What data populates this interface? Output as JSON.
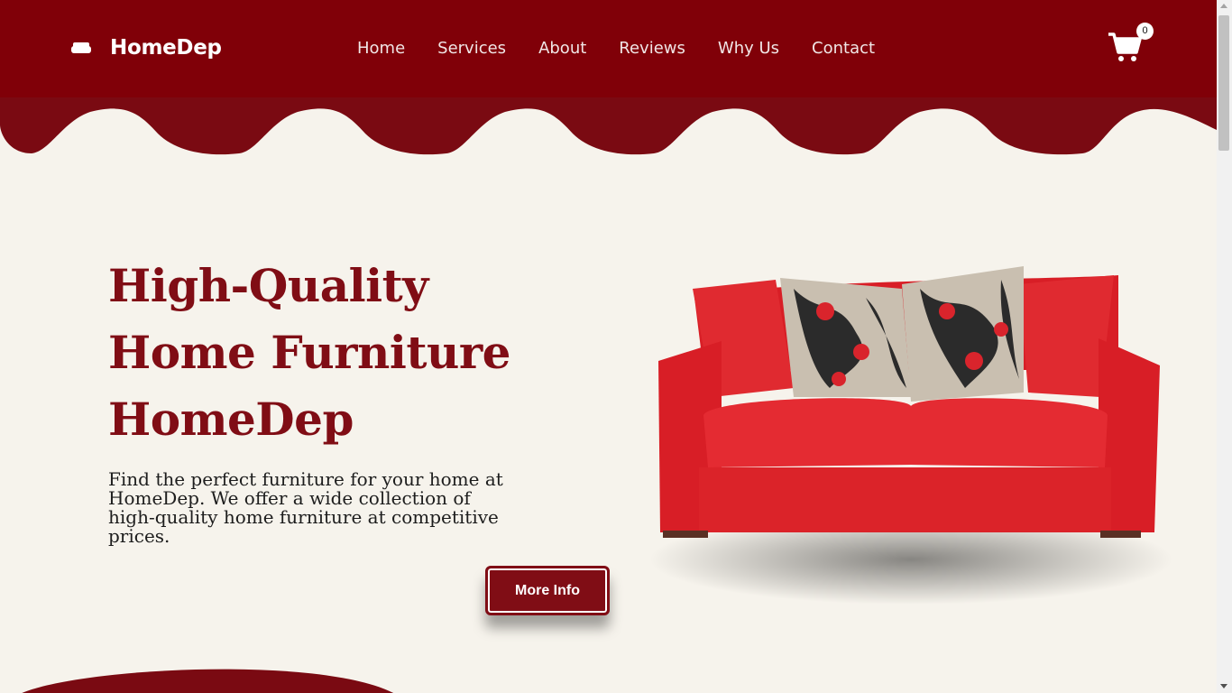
{
  "nav": {
    "brand": "HomeDep",
    "links": [
      "Home",
      "Services",
      "About",
      "Reviews",
      "Why Us",
      "Contact"
    ],
    "cart_count": "0"
  },
  "hero": {
    "title_lines": [
      "High-Quality",
      "Home Furniture",
      "HomeDep"
    ],
    "description": "Find the perfect furniture for your home at HomeDep. We offer a wide collection of high-quality home furniture at competitive prices.",
    "button_label": "More Info"
  },
  "icons": {
    "brand": "sofa-icon",
    "cart": "shopping-cart-icon"
  },
  "colors": {
    "primary": "#800008",
    "background": "#f6f3ec",
    "sofa_red": "#e3242b"
  }
}
